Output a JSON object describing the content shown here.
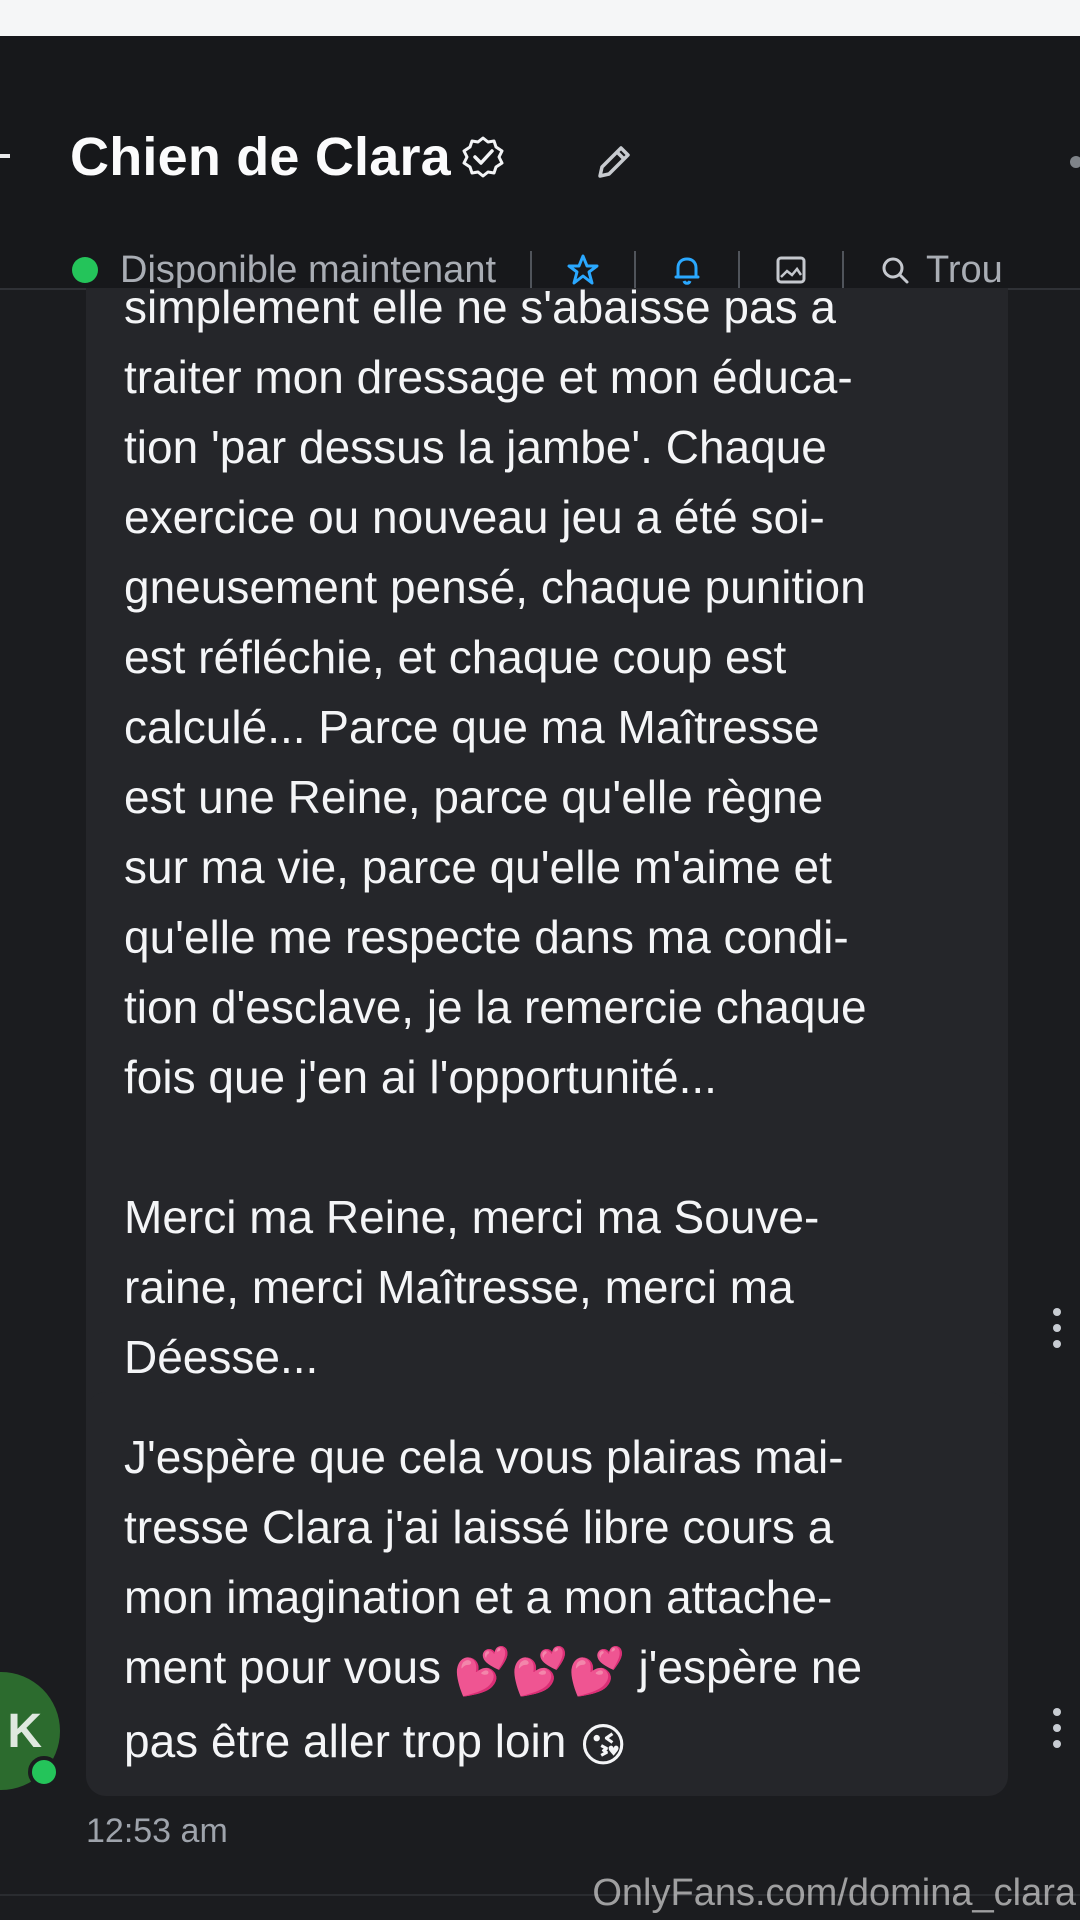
{
  "header": {
    "title": "Chien de Clara",
    "status": "Disponible maintenant",
    "search_label": "Trou"
  },
  "icons": {
    "verified": "verified-badge-icon",
    "edit": "pencil-icon",
    "star": "star-icon",
    "bell": "bell-icon",
    "media": "image-icon",
    "search": "search-icon"
  },
  "messages": [
    {
      "text": "simplement elle ne s'abaisse pas a\ntraiter mon dressage et mon éduca-\ntion 'par dessus la jambe'. Chaque\nexercice ou nouveau jeu a été soi-\ngneusement pensé, chaque punition\nest réfléchie, et chaque coup est\ncalculé... Parce que ma Maîtresse\nest une Reine, parce qu'elle règne\nsur ma vie, parce qu'elle m'aime et\nqu'elle me respecte dans ma condi-\ntion d'esclave, je la remercie chaque\nfois que j'en ai l'opportunité...\n\nMerci ma Reine, merci ma Souve-\nraine, merci Maîtresse, merci ma\nDéesse..."
    },
    {
      "text_line1": "J'espère que cela vous plairas mai-",
      "text_line2": "tresse Clara j'ai laissé libre cours a",
      "text_line3": "mon imagination et a mon attache-",
      "text_line4_pre": "ment pour vous ",
      "text_line4_post": " j'espère ne",
      "text_line5_pre": "pas être aller trop loin ",
      "emoji_hearts": "💕💕💕",
      "emoji_kiss": "😘"
    }
  ],
  "avatar_initial": "K",
  "timestamp": "12:53 am",
  "watermark": "OnlyFans.com/domina_clara",
  "colors": {
    "background": "#1b1c1f",
    "bubble": "#25262a",
    "online": "#24c45a",
    "accent": "#2aa8ff"
  }
}
